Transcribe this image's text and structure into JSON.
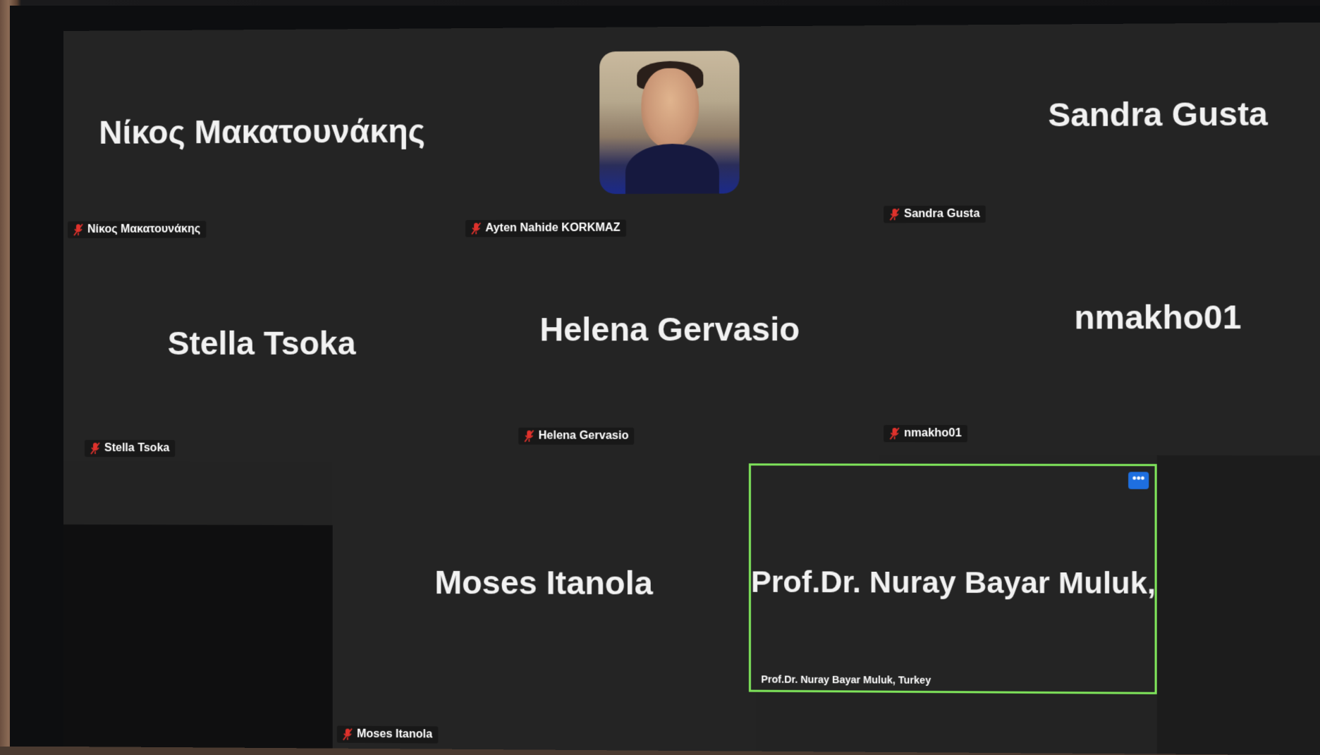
{
  "participants": [
    {
      "display_name": "Νίκος Μακατουνάκης",
      "caption": "Νίκος Μακατουνάκης",
      "muted": true
    },
    {
      "display_name": "",
      "caption": "Ayten Nahide KORKMAZ",
      "muted": true,
      "has_video": true
    },
    {
      "display_name": "Sandra Gusta",
      "caption": "Sandra Gusta",
      "muted": true
    },
    {
      "display_name": "Stella Tsoka",
      "caption": "Stella Tsoka",
      "muted": true
    },
    {
      "display_name": "Helena Gervasio",
      "caption": "Helena Gervasio",
      "muted": true
    },
    {
      "display_name": "nmakho01",
      "caption": "nmakho01",
      "muted": true
    },
    {
      "display_name": "Moses Itanola",
      "caption": "Moses Itanola",
      "muted": true
    },
    {
      "display_name": "Prof.Dr. Nuray Bayar Muluk,...",
      "caption": "Prof.Dr. Nuray Bayar Muluk, Turkey",
      "muted": false,
      "active_speaker": true
    }
  ],
  "controls": {
    "more_label": "•••"
  },
  "colors": {
    "active_speaker_border": "#7ee35a",
    "mute_icon": "#e0322c",
    "more_button": "#1e6fe0"
  }
}
